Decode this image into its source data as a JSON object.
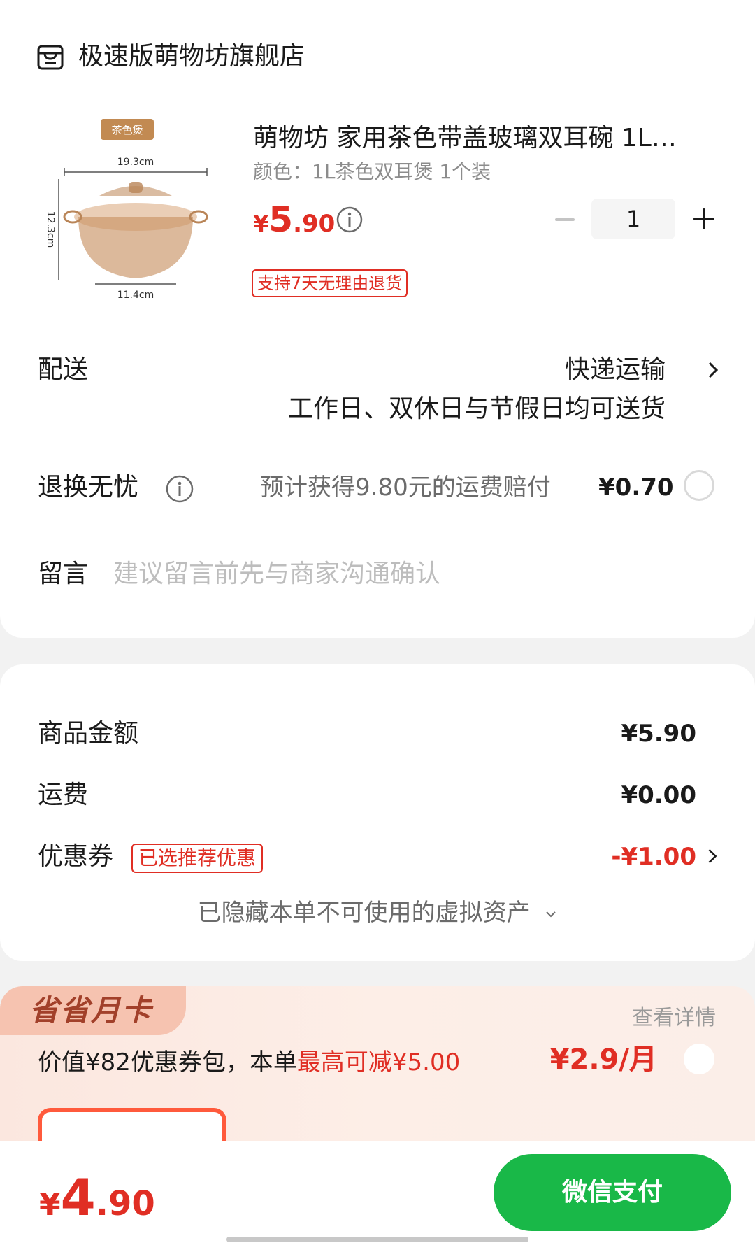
{
  "store": {
    "name": "极速版萌物坊旗舰店",
    "icon": "store-icon"
  },
  "product": {
    "image_tag": "茶色煲",
    "dims": {
      "width": "19.3cm",
      "height": "12.3cm",
      "base": "11.4cm"
    },
    "title": "萌物坊 家用茶色带盖玻璃双耳碗 1L…",
    "spec": "颜色：1L茶色双耳煲 1个装",
    "price_yen": "¥",
    "price_int": "5",
    "price_dec": ".90",
    "quantity": "1",
    "return_badge": "支持7天无理由退货"
  },
  "delivery": {
    "label": "配送",
    "method": "快递运输",
    "note": "工作日、双休日与节假日均可送货"
  },
  "returns": {
    "label": "退换无忧",
    "desc": "预计获得9.80元的运费赔付",
    "price": "¥0.70"
  },
  "message": {
    "label": "留言",
    "placeholder": "建议留言前先与商家沟通确认"
  },
  "summary": {
    "goods_label": "商品金额",
    "goods_value": "¥5.90",
    "shipping_label": "运费",
    "shipping_value": "¥0.00",
    "coupon_label": "优惠券",
    "coupon_badge": "已选推荐优惠",
    "coupon_value": "-¥1.00",
    "hidden_assets": "已隐藏本单不可使用的虚拟资产"
  },
  "promo": {
    "tag": "省省月卡",
    "details_link": "查看详情",
    "desc_prefix": "价值¥82优惠券包，本单",
    "desc_highlight": "最高可减¥5.00",
    "price": "¥2.9/月"
  },
  "bottom": {
    "total_yen": "¥",
    "total_int": "4",
    "total_dec": ".90",
    "pay_label": "微信支付"
  },
  "colors": {
    "accent_red": "#e02e24",
    "pay_green": "#19b848",
    "promo_bg": "#fbe7df"
  }
}
